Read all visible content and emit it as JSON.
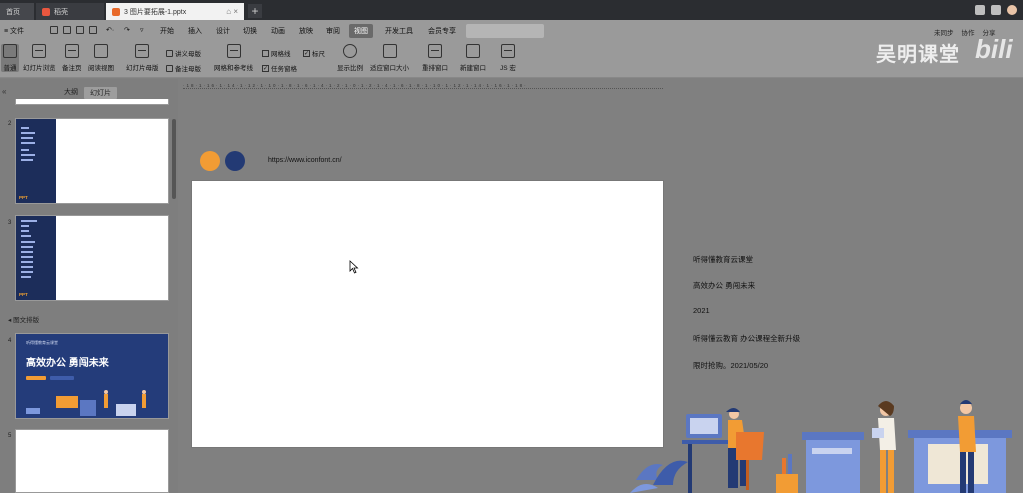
{
  "tabs": [
    {
      "label": "首页"
    },
    {
      "label": "稻壳"
    },
    {
      "label": "3 图片要拓展-1.pptx"
    }
  ],
  "menu": {
    "file": "≡ 文件",
    "items": [
      "开始",
      "插入",
      "设计",
      "切换",
      "动画",
      "放映",
      "审阅",
      "视图",
      "开发工具",
      "会员专享"
    ],
    "active": "视图",
    "right_links": [
      "未同步",
      "协作",
      "分享"
    ]
  },
  "ribbon": {
    "normal": "普通",
    "slide_sorter": "幻灯片浏览",
    "notes_page": "备注页",
    "reading_view": "阅读视图",
    "slide_master": "幻灯片母版",
    "handout_master": "讲义母版",
    "notes_master": "备注母版",
    "grid_guides": "网格和参考线",
    "gridlines": "网格线",
    "ruler": "标尺",
    "task_pane": "任务窗格",
    "zoom": "显示比例",
    "fit_window": "适应窗口大小",
    "arrange": "重排窗口",
    "new_window": "新建窗口",
    "js_macro": "JS 宏"
  },
  "watermark": {
    "brand": "吴明课堂",
    "site": "bili"
  },
  "left_panel": {
    "tab_outline": "大纲",
    "tab_slides": "幻灯片",
    "slide_numbers": [
      "2",
      "3",
      "4",
      "5"
    ],
    "section_label": "图文排版",
    "thumb_logo": "PPT",
    "thumb4_title": "高效办公 勇闯未来",
    "thumb4_small": "听得懂教育云课堂"
  },
  "canvas": {
    "ruler_text": "·18·1·16·1·14·1·12·1·10·1·8·1·6·1·4·1·2·1·0·1·2·1·4·1·6·1·8·1·10·1·12·1·14·1·16·1·18·",
    "url": "https://www.iconfont.cn/",
    "side_lines": [
      "听得懂教育云课堂",
      "高效办公 勇闯未来",
      "2021",
      "听得懂云教育 办公课程全新升级",
      "限时抢购。2021/05/20"
    ]
  },
  "colors": {
    "orange": "#f29c34",
    "navy": "#233a74",
    "active_menu": "#6a6a6a"
  }
}
